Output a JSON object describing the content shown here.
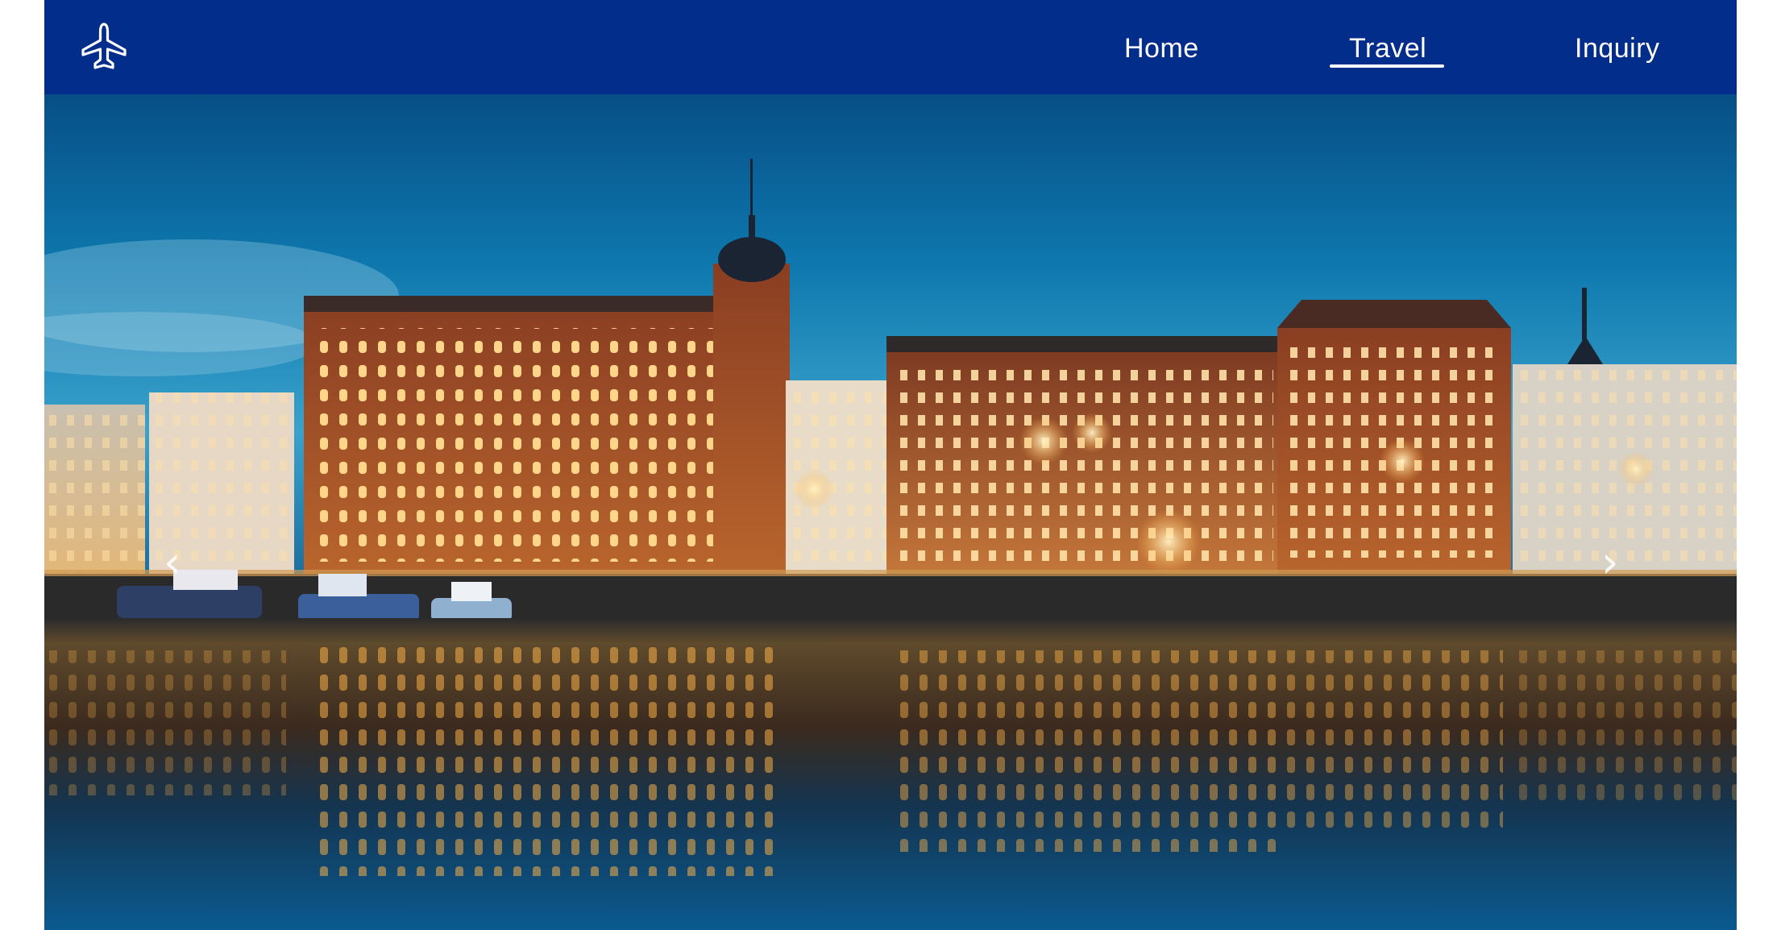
{
  "header": {
    "logo_icon": "airplane-icon",
    "brand_color": "#032d8a",
    "nav": {
      "home": "Home",
      "travel": "Travel",
      "inquiry": "Inquiry"
    },
    "active_nav": "Travel"
  },
  "hero": {
    "image": "night-city-waterfront-photo",
    "prev_icon": "chevron-left-icon",
    "next_icon": "chevron-right-icon",
    "prev_glyph": "‹",
    "next_glyph": "›"
  }
}
